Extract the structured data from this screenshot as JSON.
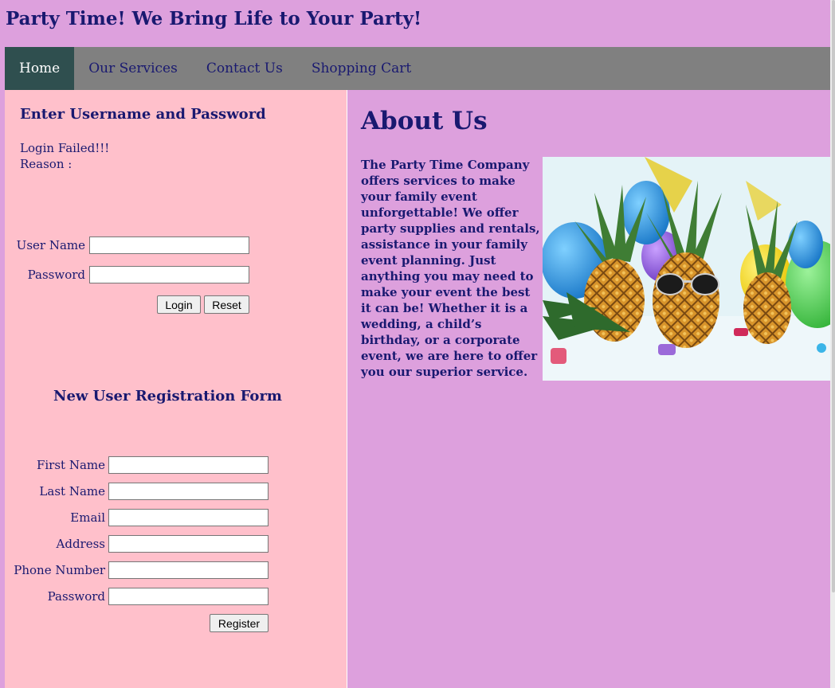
{
  "header": {
    "title": "Party Time! We Bring Life to Your Party!"
  },
  "nav": {
    "items": [
      {
        "label": "Home",
        "active": true
      },
      {
        "label": "Our Services",
        "active": false
      },
      {
        "label": "Contact Us",
        "active": false
      },
      {
        "label": "Shopping Cart",
        "active": false
      }
    ]
  },
  "login": {
    "heading": "Enter Username and Password",
    "status": "Login Failed!!!",
    "reason_label": "Reason :",
    "username_label": "User Name",
    "username_value": "",
    "password_label": "Password",
    "password_value": "",
    "login_button": "Login",
    "reset_button": "Reset"
  },
  "registration": {
    "heading": "New User Registration Form",
    "fields": [
      {
        "label": "First Name",
        "value": ""
      },
      {
        "label": "Last Name",
        "value": ""
      },
      {
        "label": "Email",
        "value": ""
      },
      {
        "label": "Address",
        "value": ""
      },
      {
        "label": "Phone Number",
        "value": ""
      },
      {
        "label": "Password",
        "value": ""
      }
    ],
    "register_button": "Register"
  },
  "about": {
    "heading": "About Us",
    "text": "The Party Time Company offers services to make your family event unforgettable! We offer party supplies and rentals, assistance in your family event planning. Just anything you may need to make your event the best it can be! Whether it is a wedding, a child’s birthday, or a corporate event, we are here to offer you our superior service."
  },
  "colors": {
    "page_background": "#dda0dd",
    "nav_background": "#808080",
    "nav_active": "#2f4f4f",
    "left_panel": "#ffc0cb",
    "text": "#191970"
  },
  "icons": {
    "hero_image": "pineapples-party-image"
  }
}
